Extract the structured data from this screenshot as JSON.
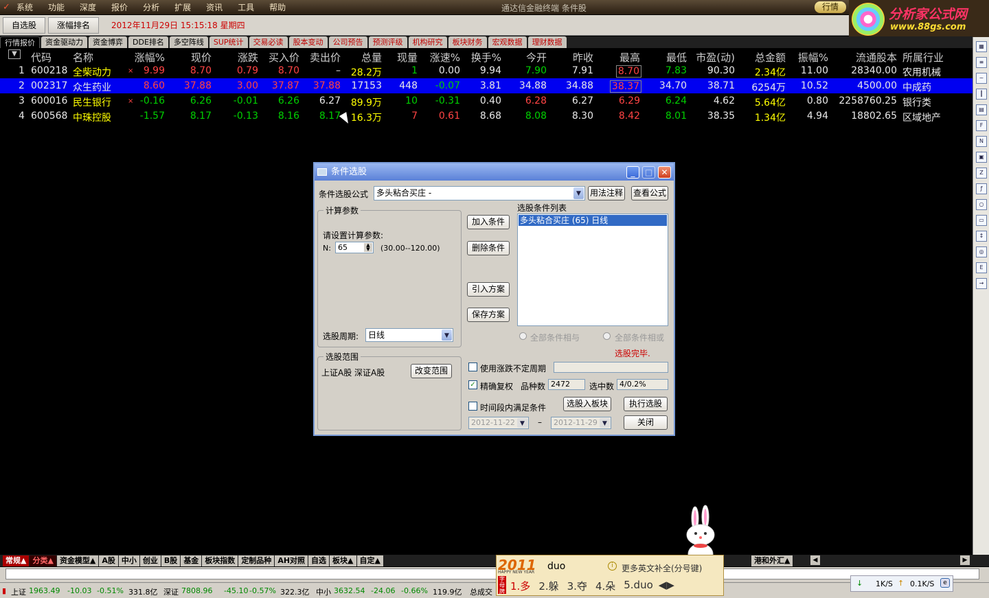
{
  "menubar": {
    "items": [
      "系统",
      "功能",
      "深度",
      "报价",
      "分析",
      "扩展",
      "资讯",
      "工具",
      "帮助"
    ],
    "app_title": "通达信金融终端 条件股",
    "quote_button": "行情"
  },
  "brand": {
    "name": "分析家公式网",
    "url": "www.88gs.com"
  },
  "toolbar": {
    "btn1": "自选股",
    "btn2": "涨幅排名",
    "datetime": "2012年11月29日  15:15:18 星期四"
  },
  "tabs": [
    "行情报价",
    "资金驱动力",
    "资金博弈",
    "DDE排名",
    "多空阵线",
    "SUP统计",
    "交易必读",
    "股本变动",
    "公司预告",
    "预测评级",
    "机构研究",
    "板块财务",
    "宏观数据",
    "理财数据"
  ],
  "table": {
    "headers": [
      "代码",
      "名称",
      "涨幅%",
      "现价",
      "涨跌",
      "买入价",
      "卖出价",
      "总量",
      "现量",
      "涨速%",
      "换手%",
      "今开",
      "昨收",
      "最高",
      "最低",
      "市盈(动)",
      "总金额",
      "振幅%",
      "流通股本",
      "所属行业"
    ],
    "rows": [
      {
        "idx": "1",
        "code": "600218",
        "name": "全柴动力",
        "mark": "×",
        "chg_pct": "9.99",
        "price": "8.70",
        "chg": "0.79",
        "bid": "8.70",
        "ask": "–",
        "vol": "28.2万",
        "cur_vol": "1",
        "speed": "0.00",
        "turnover": "9.94",
        "open": "7.90",
        "prev": "7.91",
        "high": "8.70",
        "low": "7.83",
        "pe": "90.30",
        "amount": "2.34亿",
        "amplitude": "11.00",
        "float_cap": "28340.00",
        "industry": "农用机械"
      },
      {
        "idx": "2",
        "code": "002317",
        "name": "众生药业",
        "mark": "",
        "chg_pct": "8.60",
        "price": "37.88",
        "chg": "3.00",
        "bid": "37.87",
        "ask": "37.88",
        "vol": "17153",
        "cur_vol": "448",
        "speed": "-0.07",
        "turnover": "3.81",
        "open": "34.88",
        "prev": "34.88",
        "high": "38.37",
        "low": "34.70",
        "pe": "38.71",
        "amount": "6254万",
        "amplitude": "10.52",
        "float_cap": "4500.00",
        "industry": "中成药"
      },
      {
        "idx": "3",
        "code": "600016",
        "name": "民生银行",
        "mark": "×",
        "chg_pct": "-0.16",
        "price": "6.26",
        "chg": "-0.01",
        "bid": "6.26",
        "ask": "6.27",
        "vol": "89.9万",
        "cur_vol": "10",
        "speed": "-0.31",
        "turnover": "0.40",
        "open": "6.28",
        "prev": "6.27",
        "high": "6.29",
        "low": "6.24",
        "pe": "4.62",
        "amount": "5.64亿",
        "amplitude": "0.80",
        "float_cap": "2258760.25",
        "industry": "银行类"
      },
      {
        "idx": "4",
        "code": "600568",
        "name": "中珠控股",
        "mark": "",
        "chg_pct": "-1.57",
        "price": "8.17",
        "chg": "-0.13",
        "bid": "8.16",
        "ask": "8.17",
        "vol": "16.3万",
        "cur_vol": "7",
        "speed": "0.61",
        "turnover": "8.68",
        "open": "8.08",
        "prev": "8.30",
        "high": "8.42",
        "low": "8.01",
        "pe": "38.35",
        "amount": "1.34亿",
        "amplitude": "4.94",
        "float_cap": "18802.65",
        "industry": "区域地产"
      }
    ]
  },
  "dialog": {
    "title": "条件选股",
    "formula_label": "条件选股公式",
    "formula_value": "多头粘合买庄 -",
    "usage_btn": "用法注释",
    "view_formula_btn": "查看公式",
    "params_group": "计算参数",
    "params_prompt": "请设置计算参数:",
    "param_name": "N:",
    "param_value": "65",
    "param_range": "(30.00--120.00)",
    "period_label": "选股周期:",
    "period_value": "日线",
    "add_btn": "加入条件",
    "delete_btn": "删除条件",
    "import_btn": "引入方案",
    "save_btn": "保存方案",
    "list_label": "选股条件列表",
    "list_items": [
      "多头粘合买庄 (65) 日线"
    ],
    "radio_and": "全部条件相与",
    "radio_or": "全部条件相或",
    "done_text": "选股完毕.",
    "scope_group": "选股范围",
    "scope_value": "上证A股 深证A股",
    "change_scope_btn": "改变范围",
    "chk_unfixed": "使用涨跌不定周期",
    "chk_precise": "精确复权",
    "count_label": "品种数",
    "count_value": "2472",
    "selected_label": "选中数",
    "selected_value": "4/0.2%",
    "chk_period": "时间段内满足条件",
    "to_block_btn": "选股入板块",
    "execute_btn": "执行选股",
    "date_from": "2012-11-22",
    "date_sep": "–",
    "date_to": "2012-11-29",
    "close_btn": "关闭"
  },
  "bottom_tabs": [
    "常规▲",
    "分类▲",
    "资金模型▲",
    "A股",
    "中小",
    "创业",
    "B股",
    "基金",
    "板块指数",
    "定制品种",
    "AH对照",
    "自选",
    "板块▲",
    "自定▲"
  ],
  "bottom_tabs_right": "港和外汇▲",
  "status": {
    "sh_label": "上证",
    "sh_idx": "1963.49",
    "sh_chg": "-10.03",
    "sh_pct": "-0.51%",
    "sh_amt": "331.8亿",
    "sz_label": "深证",
    "sz_idx": "7808.96",
    "sz_chg": "-45.10",
    "sz_pct": "-0.57%",
    "sz_amt": "322.3亿",
    "zx_label": "中小",
    "zx_idx": "3632.54",
    "zx_chg": "-24.06",
    "zx_pct": "-0.66%",
    "zx_amt": "119.9亿",
    "total_label": "总成交"
  },
  "ime": {
    "logo_year": "2011",
    "logo_sub": "HAPPY NEW YEAR",
    "tag": "字母牌",
    "input": "duo",
    "hint": "更多英文补全(分号键)",
    "candidates": [
      "1.多",
      "2.躲",
      "3.夺",
      "4.朵",
      "5.duo"
    ]
  },
  "net": {
    "down": "1K/S",
    "up": "0.1K/S"
  }
}
